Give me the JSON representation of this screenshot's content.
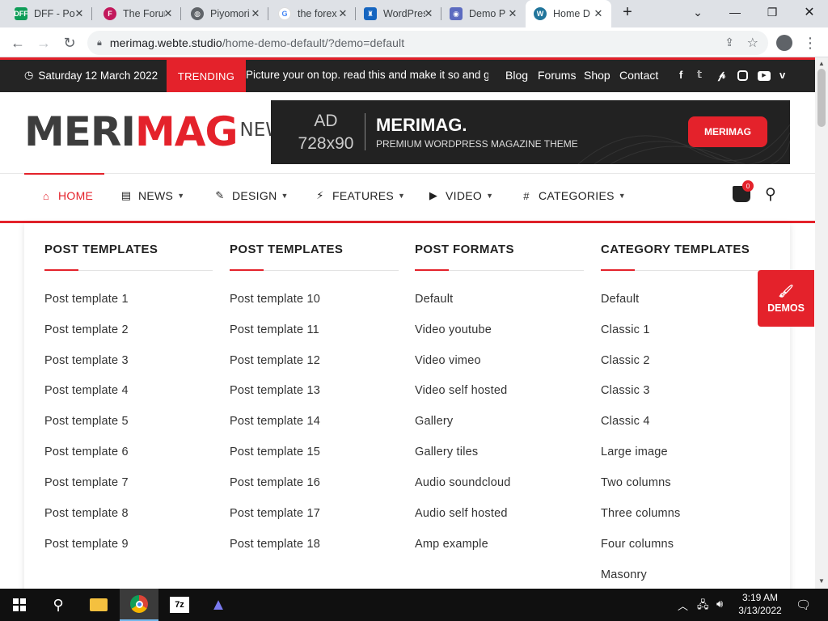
{
  "browser": {
    "tabs": [
      {
        "label": "DFF - Po",
        "favicon": "DFF",
        "color": "#0f9d58"
      },
      {
        "label": "The Forum",
        "favicon": "F",
        "color": "#c2185b"
      },
      {
        "label": "Piyomori",
        "favicon": "globe",
        "color": "#5f6368"
      },
      {
        "label": "the forex",
        "favicon": "G",
        "color": "#4285f4"
      },
      {
        "label": "WordPress",
        "favicon": "shield",
        "color": "#1565c0"
      },
      {
        "label": "Demo P",
        "favicon": "demo",
        "color": "#5c6bc0"
      },
      {
        "label": "Home D",
        "favicon": "W",
        "color": "#21759b"
      }
    ],
    "new_tab": "+",
    "url_host": "merimag.webte.studio",
    "url_path": "/home-demo-default/?demo=default"
  },
  "topbar": {
    "date": "Saturday 12 March 2022",
    "trending_label": "TRENDING",
    "ticker_text": "Picture your on top. read this and make it so and g",
    "links": [
      "Blog",
      "Forums",
      "Shop",
      "Contact"
    ],
    "social": [
      "f",
      "t",
      "p",
      "ig",
      "yt",
      "v"
    ]
  },
  "header": {
    "logo_dark": "MERI",
    "logo_red": "MAG",
    "logo_news": "NEWS",
    "ad_size_top": "AD",
    "ad_size_bottom": "728x90",
    "ad_brand": "MERIMAG.",
    "ad_tagline": "PREMIUM WORDPRESS MAGAZINE THEME",
    "ad_button": "MERIMAG"
  },
  "nav": {
    "items": [
      "HOME",
      "NEWS",
      "DESIGN",
      "FEATURES",
      "VIDEO",
      "CATEGORIES"
    ],
    "cart_count": "0"
  },
  "mega": {
    "columns": [
      {
        "title": "POST TEMPLATES",
        "items": [
          "Post template 1",
          "Post template 2",
          "Post template 3",
          "Post template 4",
          "Post template 5",
          "Post template 6",
          "Post template 7",
          "Post template 8",
          "Post template 9"
        ]
      },
      {
        "title": "POST TEMPLATES",
        "items": [
          "Post template 10",
          "Post template 11",
          "Post template 12",
          "Post template 13",
          "Post template 14",
          "Post template 15",
          "Post template 16",
          "Post template 17",
          "Post template 18"
        ]
      },
      {
        "title": "POST FORMATS",
        "items": [
          "Default",
          "Video youtube",
          "Video vimeo",
          "Video self hosted",
          "Gallery",
          "Gallery tiles",
          "Audio soundcloud",
          "Audio self hosted",
          "Amp example"
        ]
      },
      {
        "title": "CATEGORY TEMPLATES",
        "items": [
          "Default",
          "Classic 1",
          "Classic 2",
          "Classic 3",
          "Classic 4",
          "Large image",
          "Two columns",
          "Three columns",
          "Four columns",
          "Masonry"
        ]
      }
    ]
  },
  "demos_label": "DEMOS",
  "taskbar": {
    "time": "3:19 AM",
    "date": "3/13/2022",
    "apps": [
      "file-explorer",
      "chrome",
      "7zip",
      "app"
    ]
  },
  "colors": {
    "accent": "#e4222b",
    "dark": "#242424"
  }
}
